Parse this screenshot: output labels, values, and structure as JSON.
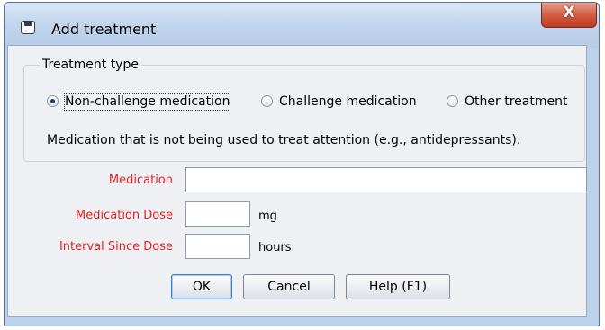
{
  "window": {
    "title": "Add treatment",
    "close_glyph": "X"
  },
  "treatment_type": {
    "group_label": "Treatment type",
    "options": [
      {
        "label": "Non-challenge medication",
        "checked": true
      },
      {
        "label": "Challenge medication",
        "checked": false
      },
      {
        "label": "Other treatment",
        "checked": false
      }
    ],
    "description": "Medication that is not being used to treat attention (e.g., antidepressants)."
  },
  "form": {
    "medication_label": "Medication",
    "medication_value": "",
    "dose_label": "Medication Dose",
    "dose_value": "",
    "dose_unit": "mg",
    "interval_label": "Interval Since Dose",
    "interval_value": "",
    "interval_unit": "hours"
  },
  "buttons": {
    "ok": "OK",
    "cancel": "Cancel",
    "help": "Help (F1)"
  },
  "colors": {
    "required_label": "#e32424",
    "title_bar": "#c3d6ee",
    "close_button": "#d35d43"
  }
}
